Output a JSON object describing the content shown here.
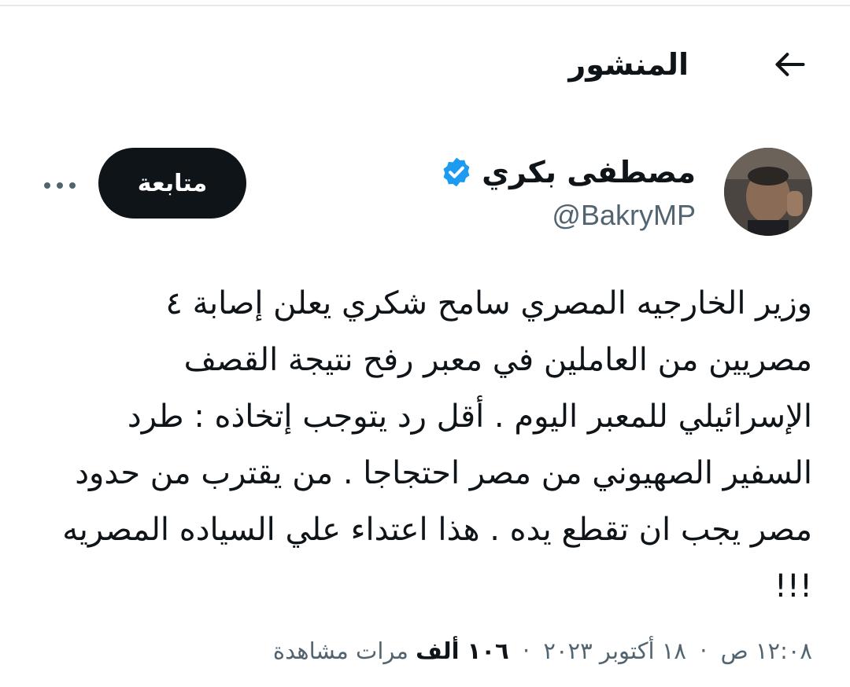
{
  "header": {
    "title": "المنشور"
  },
  "author": {
    "display_name": "مصطفى بكري",
    "handle": "@BakryMP",
    "verified": true,
    "follow_label": "متابعة"
  },
  "tweet": {
    "lines": [
      "وزير الخارجيه المصري سامح شكري يعلن إصابة ٤",
      "مصريين من العاملين في معبر رفح نتيجة القصف",
      "الإسرائيلي للمعبر اليوم . أقل رد يتوجب إتخاذه : طرد",
      "السفير الصهيوني من مصر احتجاجا . من يقترب من حدود",
      "مصر يجب ان تقطع يده . هذا اعتداء علي السياده المصريه",
      "!!!"
    ]
  },
  "meta": {
    "time": "١٢:٠٨ ص",
    "date": "١٨ أكتوبر ٢٠٢٣",
    "views_count": "١٠٦ ألف",
    "views_label": "مرات مشاهدة",
    "separator": "·"
  },
  "icons": {
    "back": "arrow-back-icon",
    "verified": "verified-badge-icon",
    "more": "more-options-icon"
  },
  "colors": {
    "primary_text": "#0f1419",
    "secondary_text": "#536471",
    "verified_blue": "#1d9bf0",
    "button_bg": "#0f1419"
  }
}
